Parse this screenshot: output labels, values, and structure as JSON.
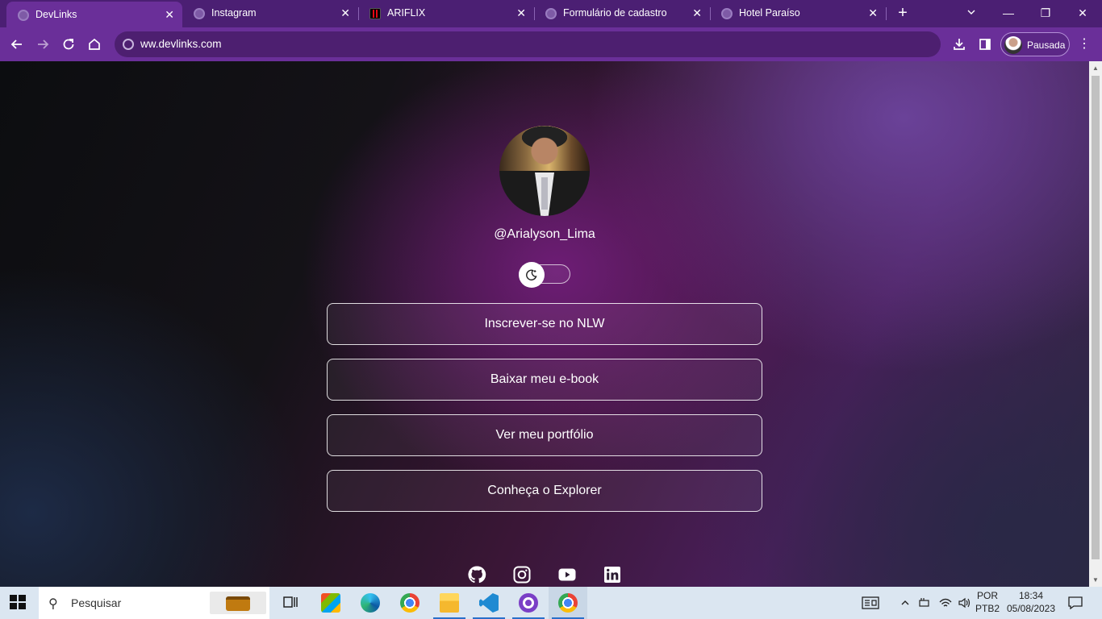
{
  "browser": {
    "tabs": [
      {
        "title": "DevLinks",
        "active": true,
        "favicon": "globe-icon"
      },
      {
        "title": "Instagram",
        "active": false,
        "favicon": "globe-icon"
      },
      {
        "title": "ARIFLIX",
        "active": false,
        "favicon": "netflix-icon"
      },
      {
        "title": "Formulário de cadastro",
        "active": false,
        "favicon": "globe-icon"
      },
      {
        "title": "Hotel Paraíso",
        "active": false,
        "favicon": "globe-icon"
      }
    ],
    "address": "ww.devlinks.com",
    "profile_label": "Pausada",
    "accent": "#6a2f99"
  },
  "page": {
    "username": "@Arialyson_Lima",
    "theme_toggle_icon": "moon-icon",
    "links": [
      {
        "label": "Inscrever-se no NLW"
      },
      {
        "label": "Baixar meu e-book"
      },
      {
        "label": "Ver meu portfólio"
      },
      {
        "label": "Conheça o Explorer"
      }
    ],
    "socials": [
      "github-icon",
      "instagram-icon",
      "youtube-icon",
      "linkedin-icon"
    ]
  },
  "taskbar": {
    "search_placeholder": "Pesquisar",
    "language": "POR",
    "keyboard": "PTB2",
    "time": "18:34",
    "date": "05/08/2023"
  }
}
